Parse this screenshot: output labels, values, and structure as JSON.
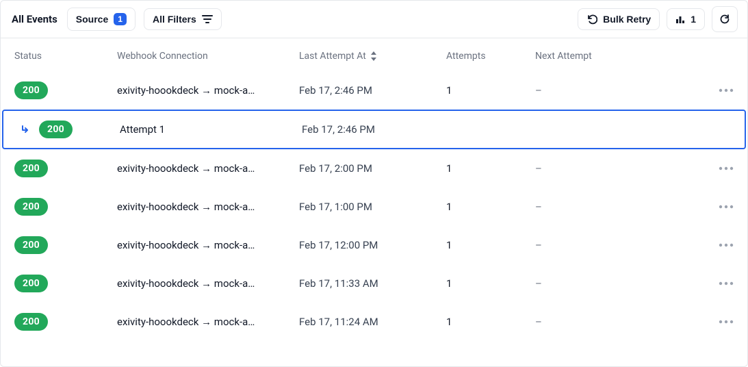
{
  "toolbar": {
    "all_events": "All Events",
    "source_label": "Source",
    "source_count": "1",
    "all_filters": "All Filters",
    "bulk_retry": "Bulk Retry",
    "metrics_count": "1"
  },
  "columns": {
    "status": "Status",
    "connection": "Webhook Connection",
    "last_attempt": "Last Attempt At",
    "attempts": "Attempts",
    "next_attempt": "Next Attempt"
  },
  "rows": [
    {
      "status": "200",
      "connection": "exivity-hoookdeck → mock-a…",
      "last_attempt": "Feb 17, 2:46 PM",
      "attempts": "1",
      "next": "–"
    },
    {
      "sub": true,
      "status": "200",
      "label": "Attempt 1",
      "last_attempt": "Feb 17, 2:46 PM"
    },
    {
      "status": "200",
      "connection": "exivity-hoookdeck → mock-a…",
      "last_attempt": "Feb 17, 2:00 PM",
      "attempts": "1",
      "next": "–"
    },
    {
      "status": "200",
      "connection": "exivity-hoookdeck → mock-a…",
      "last_attempt": "Feb 17, 1:00 PM",
      "attempts": "1",
      "next": "–"
    },
    {
      "status": "200",
      "connection": "exivity-hoookdeck → mock-a…",
      "last_attempt": "Feb 17, 12:00 PM",
      "attempts": "1",
      "next": "–"
    },
    {
      "status": "200",
      "connection": "exivity-hoookdeck → mock-a…",
      "last_attempt": "Feb 17, 11:33 AM",
      "attempts": "1",
      "next": "–"
    },
    {
      "status": "200",
      "connection": "exivity-hoookdeck → mock-a…",
      "last_attempt": "Feb 17, 11:24 AM",
      "attempts": "1",
      "next": "–"
    }
  ]
}
